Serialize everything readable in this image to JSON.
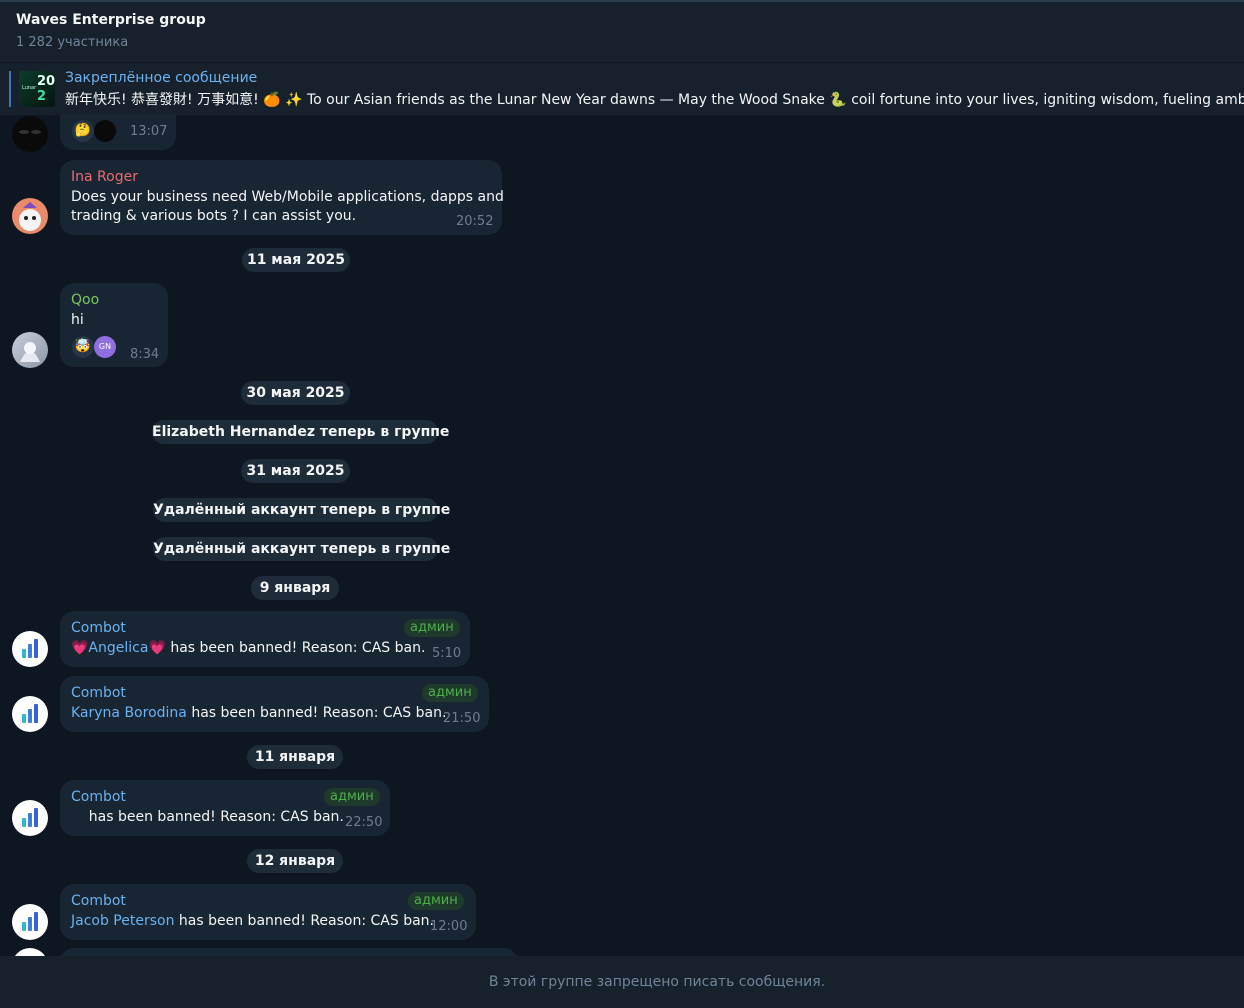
{
  "header": {
    "title": "Waves Enterprise group",
    "subtitle": "1 282 участника"
  },
  "pinned": {
    "label": "Закреплённое сообщение",
    "text": "新年快乐! 恭喜發財! 万事如意! 🍊 ✨ To our Asian friends as the Lunar New Year dawns — May the Wood Snake 🐍 coil fortune into your lives, igniting wisdom, fueling ambitio",
    "thumb_line1": "20",
    "thumb_line2": "2"
  },
  "messages": [
    {
      "time": "13:07",
      "reactions": [
        "🤔",
        "●"
      ]
    },
    {
      "sender": "Ina Roger",
      "sender_color": "#e86d6d",
      "lines": [
        "Does your business need Web/Mobile applications, dapps and",
        "trading & various bots ? I can assist you."
      ],
      "time": "20:52"
    },
    {
      "sender": "Qoo",
      "sender_color": "#7bc862",
      "lines": [
        "hi"
      ],
      "time": "8:34",
      "reactions": [
        "🤯",
        "GN"
      ]
    },
    {
      "sender": "Combot",
      "badge": "админ",
      "link": "💗Angelica💗",
      "rest": " has been banned! Reason: CAS ban.",
      "time": "5:10"
    },
    {
      "sender": "Combot",
      "badge": "админ",
      "link": "Karyna Borodina",
      "rest": " has been banned! Reason: CAS ban.",
      "time": "21:50"
    },
    {
      "sender": "Combot",
      "badge": "админ",
      "link": "",
      "rest": "    has been banned! Reason: CAS ban.",
      "time": "22:50"
    },
    {
      "sender": "Combot",
      "badge": "админ",
      "link": "Jacob Peterson",
      "rest": " has been banned! Reason: CAS ban.",
      "time": "12:00"
    }
  ],
  "service": {
    "date_may11": "11 мая 2025",
    "date_may30": "30 мая 2025",
    "joined_elizabeth": "Elizabeth Hernandez теперь в группе",
    "date_may31": "31 мая 2025",
    "joined_deleted_1": "Удалённый аккаунт теперь в группе",
    "joined_deleted_2": "Удалённый аккаунт теперь в группе",
    "date_jan9": "9 января",
    "date_jan11": "11 января",
    "date_jan12": "12 января"
  },
  "footer": {
    "text": "В этой группе запрещено писать сообщения."
  },
  "colors": {
    "background": "#0e1621",
    "bubble": "#182533",
    "header": "#17212b",
    "link": "#6ab2f2",
    "admin_badge": "#4fae4e"
  }
}
